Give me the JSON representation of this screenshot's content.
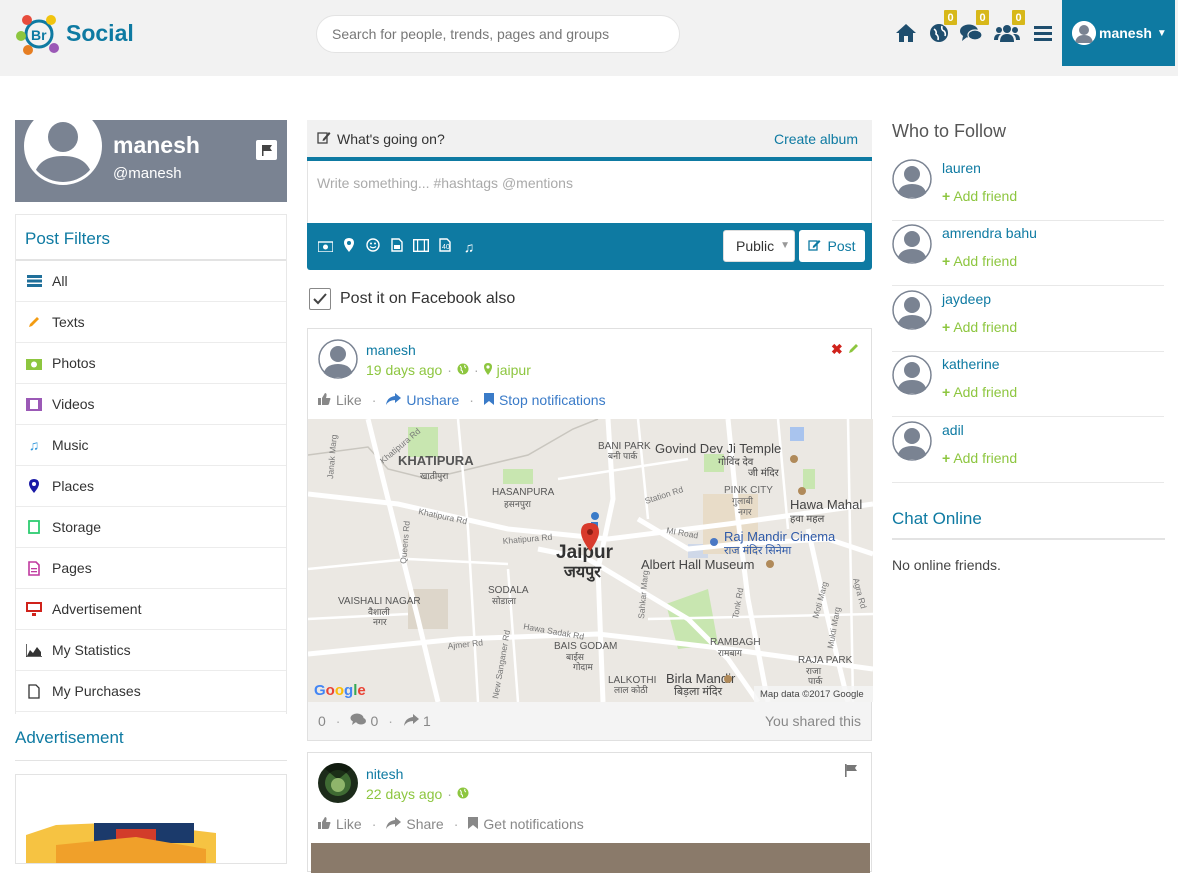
{
  "app": {
    "logo_text": "Br Social"
  },
  "header": {
    "search_placeholder": "Search for people, trends, pages and groups",
    "badges": {
      "globe": "0",
      "messages": "0",
      "friends": "0"
    },
    "user": "manesh"
  },
  "profile": {
    "name": "manesh",
    "handle": "@manesh"
  },
  "filters": {
    "title": "Post Filters",
    "items": [
      {
        "label": "All",
        "icon": "list-icon",
        "color": "#1f6f9a"
      },
      {
        "label": "Texts",
        "icon": "pencil-icon",
        "color": "#f39c12"
      },
      {
        "label": "Photos",
        "icon": "camera-icon",
        "color": "#8dc63f"
      },
      {
        "label": "Videos",
        "icon": "film-icon",
        "color": "#9b59b6"
      },
      {
        "label": "Music",
        "icon": "music-icon",
        "color": "#3498db"
      },
      {
        "label": "Places",
        "icon": "map-marker-icon",
        "color": "#1a1aa6"
      },
      {
        "label": "Storage",
        "icon": "storage-icon",
        "color": "#2ecc71"
      },
      {
        "label": "Pages",
        "icon": "file-icon",
        "color": "#c0399f"
      },
      {
        "label": "Advertisement",
        "icon": "monitor-icon",
        "color": "#d0221b"
      },
      {
        "label": "My Statistics",
        "icon": "chart-icon",
        "color": "#333333"
      },
      {
        "label": "My Purchases",
        "icon": "document-icon",
        "color": "#333333"
      }
    ]
  },
  "advertisement": {
    "title": "Advertisement"
  },
  "composer": {
    "prompt": "What's going on?",
    "create_album": "Create album",
    "placeholder": "Write something... #hashtags @mentions",
    "privacy": "Public",
    "post_label": "Post",
    "facebook_label": "Post it on Facebook also"
  },
  "posts": [
    {
      "author": "manesh",
      "time": "19 days ago",
      "location": "jaipur",
      "actions": [
        "Like",
        "Unshare",
        "Stop notifications"
      ],
      "likes": "0",
      "comments": "0",
      "shares": "1",
      "shared_note": "You shared this",
      "map": {
        "labels": [
          "KHATIPURA",
          "खातीपुरा",
          "HASANPURA",
          "हसनपुरा",
          "BANI PARK",
          "बनी पार्क",
          "Govind Dev Ji Temple",
          "गोविंद देव जी मंदिर",
          "PINK CITY",
          "गुलाबी नगर",
          "Hawa Mahal",
          "हवा महल",
          "Raj Mandir Cinema",
          "राज मंदिर सिनेमा",
          "Albert Hall Museum",
          "Jaipur",
          "जयपुर",
          "VAISHALI NAGAR",
          "वैशाली नगर",
          "SODALA",
          "सोडाला",
          "BAIS GODAM",
          "बाईस गोदाम",
          "RAMBAGH",
          "रामबाग",
          "RAJA PARK",
          "राजा पार्क",
          "LALKOTHI",
          "लाल कोठी",
          "Birla Mandir",
          "बिड़ला मंदिर",
          "Khatipura Rd",
          "Station Rd",
          "MI Road",
          "Ajmer Rd",
          "Hawa Sadak Rd",
          "Tonk Rd",
          "Janak Marg",
          "Queens Rd",
          "New Sanganer Rd",
          "Sahkar Marg",
          "Moti Marg",
          "Agra Rd",
          "Mukti Marg",
          "Google",
          "Map data ©2017 Google"
        ]
      }
    },
    {
      "author": "nitesh",
      "time": "22 days ago",
      "actions": [
        "Like",
        "Share",
        "Get notifications"
      ]
    }
  ],
  "who_to_follow": {
    "title": "Who to Follow",
    "add_label": "Add friend",
    "people": [
      "lauren",
      "amrendra bahu",
      "jaydeep",
      "katherine",
      "adil"
    ]
  },
  "chat": {
    "title": "Chat Online",
    "empty": "No online friends."
  }
}
